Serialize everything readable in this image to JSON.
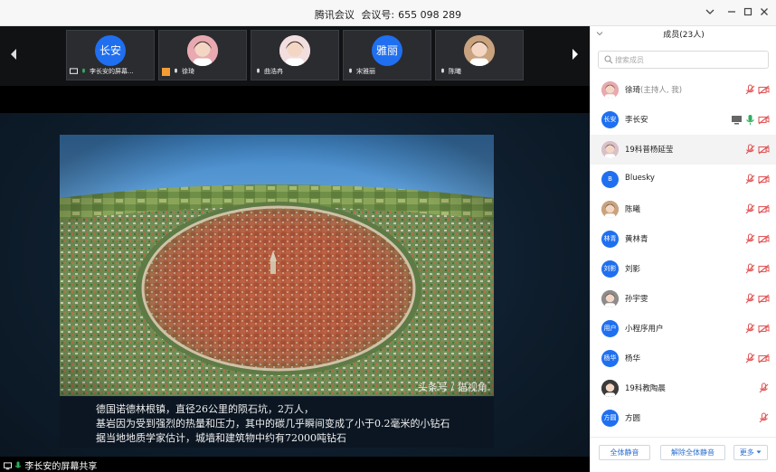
{
  "titlebar": {
    "app_name": "腾讯会议",
    "meeting_id_label": "会议号:",
    "meeting_id": "655 098 289"
  },
  "thumbnails": [
    {
      "avatar_text": "长安",
      "avatar_color": "#1f6ff0",
      "label": "李长安的屏幕..."
    },
    {
      "avatar_text": "",
      "avatar_color": "#e8a9b0",
      "label": "徐琦"
    },
    {
      "avatar_text": "",
      "avatar_color": "#f2dede",
      "label": "曲浩冉"
    },
    {
      "avatar_text": "雅丽",
      "avatar_color": "#1f6ff0",
      "label": "宋雅丽"
    },
    {
      "avatar_text": "",
      "avatar_color": "#c9a27e",
      "label": "陈曦"
    }
  ],
  "slide": {
    "watermark": "头条号 / 猫视角",
    "caption_lines": [
      "德国诺德林根镇，直径26公里的陨石坑，2万人，",
      "基岩因为受到强烈的热量和压力，其中的碳几乎瞬间变成了小于0.2毫米的小钻石",
      "据当地地质学家估计，城墙和建筑物中约有72000吨钻石"
    ]
  },
  "share_bar": {
    "label": "李长安的屏幕共享"
  },
  "panel": {
    "title": "成员(23人)",
    "search_placeholder": "搜索成员",
    "members": [
      {
        "avatar_text": "",
        "avatar_color": "#e8a9b0",
        "name": "徐琦",
        "sub": "(主持人, 我)",
        "screen": false,
        "mic": "muted",
        "cam": true
      },
      {
        "avatar_text": "长安",
        "avatar_color": "#1f6ff0",
        "name": "李长安",
        "sub": "",
        "screen": true,
        "mic": "on",
        "cam": true
      },
      {
        "avatar_text": "",
        "avatar_color": "#d9c0c8",
        "name": "19科普杨延莹",
        "sub": "",
        "screen": false,
        "mic": "muted",
        "cam": true
      },
      {
        "avatar_text": "B",
        "avatar_color": "#1f6ff0",
        "name": "Bluesky",
        "sub": "",
        "screen": false,
        "mic": "muted",
        "cam": true
      },
      {
        "avatar_text": "",
        "avatar_color": "#c9a27e",
        "name": "陈曦",
        "sub": "",
        "screen": false,
        "mic": "muted",
        "cam": true
      },
      {
        "avatar_text": "林青",
        "avatar_color": "#1f6ff0",
        "name": "黄林青",
        "sub": "",
        "screen": false,
        "mic": "muted",
        "cam": true
      },
      {
        "avatar_text": "刘影",
        "avatar_color": "#1f6ff0",
        "name": "刘影",
        "sub": "",
        "screen": false,
        "mic": "muted",
        "cam": true
      },
      {
        "avatar_text": "",
        "avatar_color": "#8c8c8c",
        "name": "孙宇雯",
        "sub": "",
        "screen": false,
        "mic": "muted",
        "cam": true
      },
      {
        "avatar_text": "用户",
        "avatar_color": "#1f6ff0",
        "name": "小程序用户",
        "sub": "",
        "screen": false,
        "mic": "muted",
        "cam": true
      },
      {
        "avatar_text": "杨华",
        "avatar_color": "#1f6ff0",
        "name": "杨华",
        "sub": "",
        "screen": false,
        "mic": "muted",
        "cam": true
      },
      {
        "avatar_text": "",
        "avatar_color": "#3a3a3a",
        "name": "19科教陶晨",
        "sub": "",
        "screen": false,
        "mic": "muted",
        "cam": false
      },
      {
        "avatar_text": "方圆",
        "avatar_color": "#1f6ff0",
        "name": "方圆",
        "sub": "",
        "screen": false,
        "mic": "muted",
        "cam": false
      }
    ],
    "footer": {
      "mute_all": "全体静音",
      "unmute_all": "解除全体静音",
      "more": "更多"
    }
  },
  "colors": {
    "accent": "#1f6ff0",
    "muted_red": "#e25b5b",
    "mic_green": "#2fae5a"
  }
}
